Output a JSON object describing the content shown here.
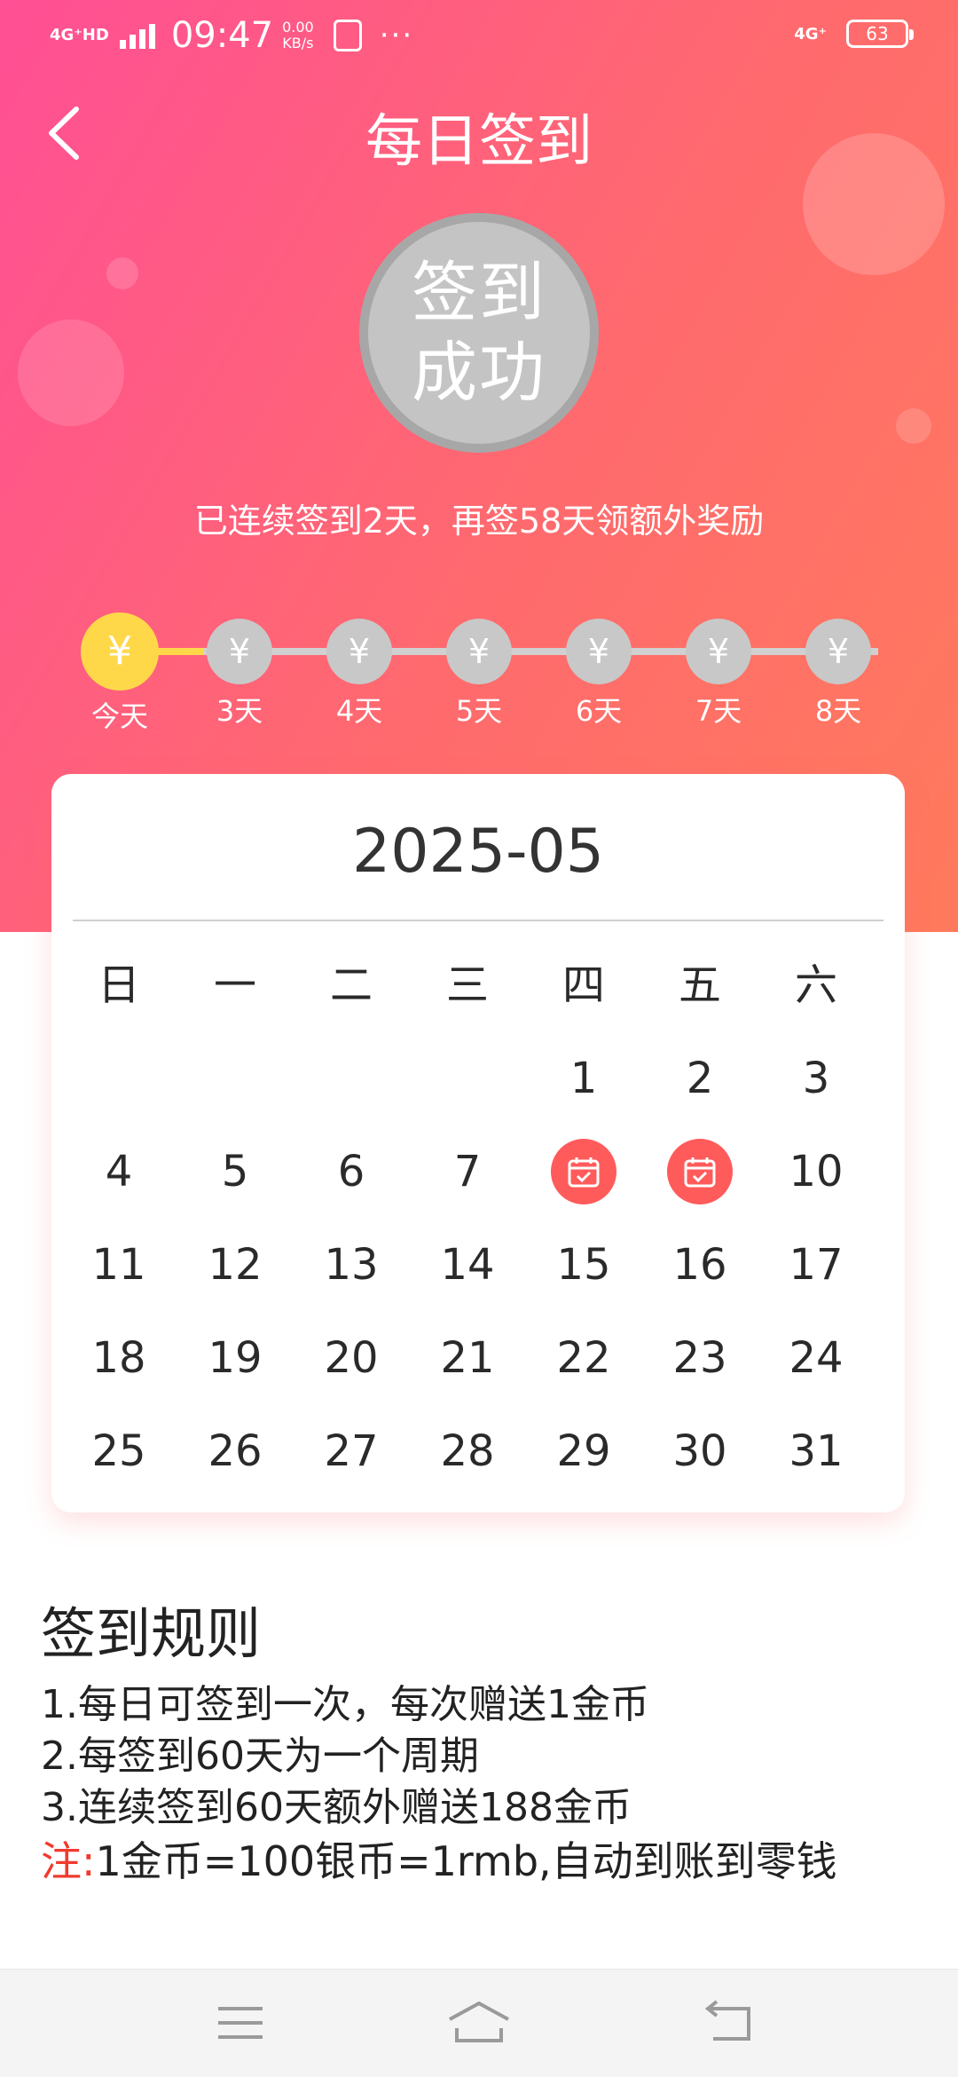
{
  "status_bar": {
    "network": "4G⁺HD",
    "time": "09:47",
    "speed_value": "0.00",
    "speed_unit": "KB/s",
    "more": "···",
    "network_right": "4G⁺",
    "battery": "63"
  },
  "header": {
    "title": "每日签到"
  },
  "success_badge": {
    "line1": "签到",
    "line2": "成功"
  },
  "streak_message": "已连续签到2天，再签58天领额外奖励",
  "reward_track": {
    "coin_symbol": "¥",
    "steps": [
      {
        "label": "今天",
        "reached": true
      },
      {
        "label": "3天",
        "reached": false
      },
      {
        "label": "4天",
        "reached": false
      },
      {
        "label": "5天",
        "reached": false
      },
      {
        "label": "6天",
        "reached": false
      },
      {
        "label": "7天",
        "reached": false
      },
      {
        "label": "8天",
        "reached": false
      }
    ]
  },
  "calendar": {
    "month": "2025-05",
    "weekdays": [
      "日",
      "一",
      "二",
      "三",
      "四",
      "五",
      "六"
    ],
    "first_weekday_index": 4,
    "days_in_month": 31,
    "signed_days": [
      8,
      9
    ]
  },
  "rules": {
    "title": "签到规则",
    "items": [
      "1.每日可签到一次，每次赠送1金币",
      "2.每签到60天为一个周期",
      "3.连续签到60天额外赠送188金币"
    ],
    "note_label": "注:",
    "note_text": "1金币=100银币=1rmb,自动到账到零钱"
  },
  "colors": {
    "accent_gradient_start": "#ff4f95",
    "accent_gradient_end": "#ff7a5c",
    "reward_gold": "#ffd84a",
    "signed_red": "#ff5b5b",
    "note_red": "#f03a2e"
  }
}
